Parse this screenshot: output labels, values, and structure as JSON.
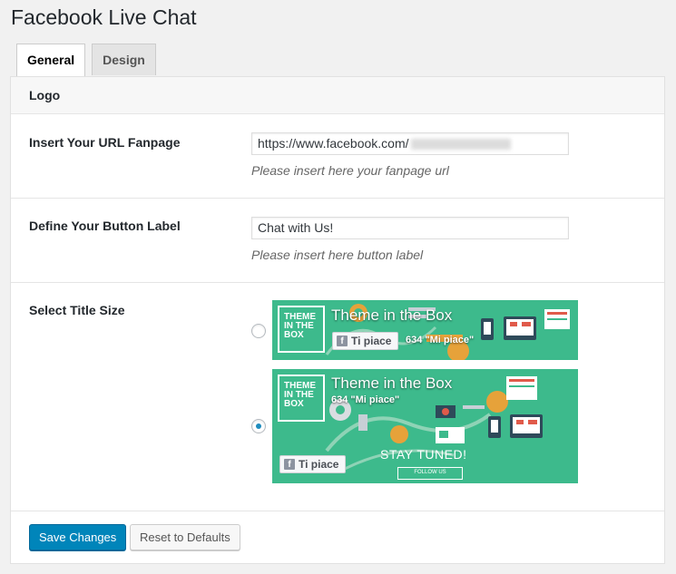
{
  "page": {
    "title": "Facebook Live Chat"
  },
  "tabs": [
    {
      "label": "General",
      "active": true
    },
    {
      "label": "Design",
      "active": false
    }
  ],
  "section": {
    "title": "Logo"
  },
  "fields": {
    "url": {
      "label": "Insert Your URL Fanpage",
      "value": "https://www.facebook.com/",
      "hint": "Please insert here your fanpage url"
    },
    "button_label": {
      "label": "Define Your Button Label",
      "value": "Chat with Us!",
      "hint": "Please insert here button label"
    },
    "title_size": {
      "label": "Select Title Size",
      "options": [
        {
          "selected": false,
          "logo_text": "THEME IN THE BOX",
          "page_name": "Theme in the Box",
          "like_label": "Ti piace",
          "likes": "634 \"Mi piace\""
        },
        {
          "selected": true,
          "logo_text": "THEME IN THE BOX",
          "page_name": "Theme in the Box",
          "like_label": "Ti piace",
          "likes": "634 \"Mi piace\"",
          "tagline": "STAY TUNED!",
          "follow": "FOLLOW US"
        }
      ]
    }
  },
  "footer": {
    "save_label": "Save Changes",
    "reset_label": "Reset to Defaults"
  },
  "colors": {
    "banner": "#3dba8c",
    "primary": "#0085ba",
    "radio_selected": "#1e8cbe"
  },
  "icons": [
    "facebook-f-icon",
    "radio-icon"
  ]
}
